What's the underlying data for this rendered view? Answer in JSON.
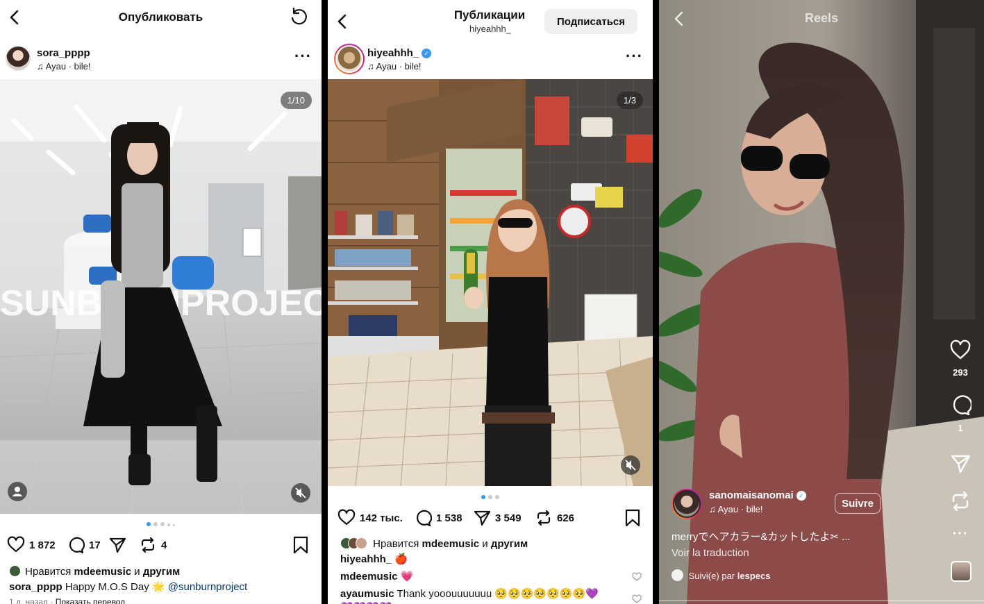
{
  "post1": {
    "header_title": "Опубликовать",
    "username": "sora_pppp",
    "music": "Ayau · bile!",
    "counter": "1/10",
    "overlay_text": "SUNBURNPROJECT",
    "likes": "1 872",
    "comments": "17",
    "reposts": "4",
    "liked_by_prefix": "Нравится",
    "liked_by_user": "mdeemusic",
    "liked_by_and": "и",
    "liked_by_others": "другим",
    "caption_user": "sora_pppp",
    "caption_text": "Happy M.O.S Day 🌟",
    "caption_mention": "@sunburnproject",
    "time_ago": "1 д. назад",
    "translate_link": "Показать перевод"
  },
  "post2": {
    "header_title": "Публикации",
    "header_subtitle": "hiyeahhh_",
    "follow_label": "Подписаться",
    "username": "hiyeahhh_",
    "music": "Ayau · bile!",
    "counter": "1/3",
    "likes": "142 тыс.",
    "comments": "1 538",
    "shares": "3 549",
    "reposts": "626",
    "liked_by_prefix": "Нравится",
    "liked_by_user": "mdeemusic",
    "liked_by_and": "и",
    "liked_by_others": "другим",
    "caption_user": "hiyeahhh_",
    "caption_text": "🍎",
    "comment1_user": "mdeemusic",
    "comment1_text": "💗",
    "comment2_user": "ayaumusic",
    "comment2_text": "Thank yooouuuuuuu 🥺🥺🥺🥺🥺🥺🥺💜",
    "comment2_more": "💜💜💜💜"
  },
  "reel": {
    "title": "Reels",
    "likes": "293",
    "comments": "1",
    "username": "sanomaisanomai",
    "music": "Ayau · bile!",
    "follow_label": "Suivre",
    "caption": "merryでヘアカラー&カットしたよ✂ ...",
    "translate": "Voir la traduction",
    "followed_prefix": "Suivi(e) par",
    "followed_user": "lespecs"
  },
  "colors": {
    "accent": "#3897f0",
    "link": "#00376b"
  }
}
